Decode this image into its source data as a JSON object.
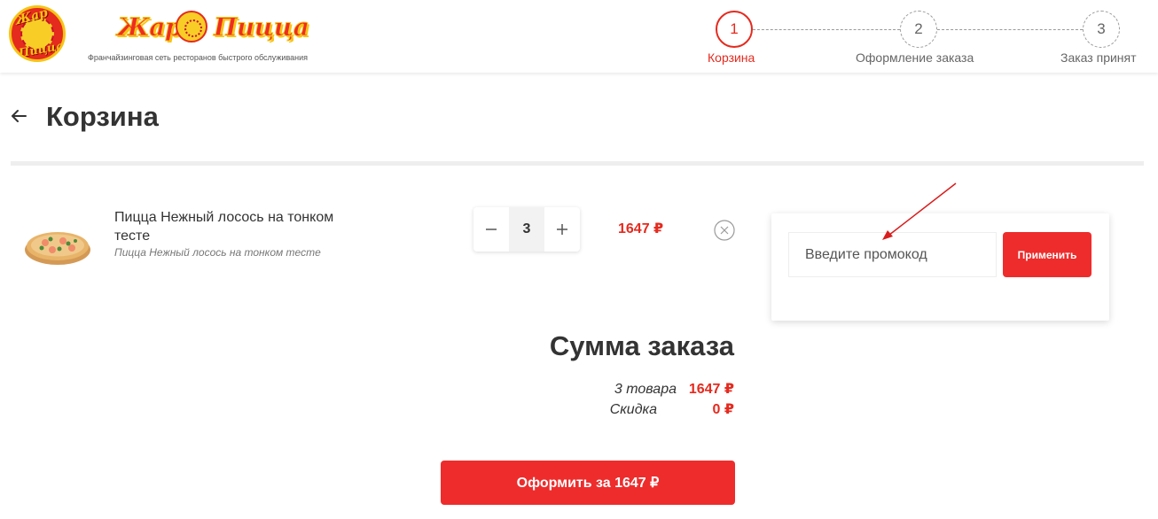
{
  "brand": {
    "round_logo_top": "Жар",
    "round_logo_bottom": "Пицца",
    "name_part1": "Жар",
    "name_part2": "Пицца",
    "tagline": "Франчайзинговая сеть ресторанов быстрого обслуживания",
    "colors": {
      "primary": "#e52a1e",
      "accent": "#f6c415"
    }
  },
  "steps": [
    {
      "number": "1",
      "label": "Корзина",
      "active": true
    },
    {
      "number": "2",
      "label": "Оформление заказа",
      "active": false
    },
    {
      "number": "3",
      "label": "Заказ принят",
      "active": false
    }
  ],
  "page": {
    "back_icon": "arrow-left-icon",
    "title": "Корзина"
  },
  "cart": {
    "items": [
      {
        "image": "pizza-image",
        "name": "Пицца Нежный лосось на тонком тесте",
        "description": "Пицца Нежный лосось на тонком тесте",
        "quantity": "3",
        "decrement_icon": "minus-icon",
        "increment_icon": "plus-icon",
        "price": "1647 ₽",
        "remove_icon": "close-circle-icon"
      }
    ]
  },
  "promo": {
    "placeholder": "Введите промокод",
    "value": "",
    "apply_label": "Применить"
  },
  "summary": {
    "title": "Сумма заказа",
    "items_label": "3 товара",
    "items_value": "1647 ₽",
    "discount_label": "Скидка",
    "discount_value": "0 ₽",
    "checkout_label": "Оформить за 1647 ₽"
  }
}
